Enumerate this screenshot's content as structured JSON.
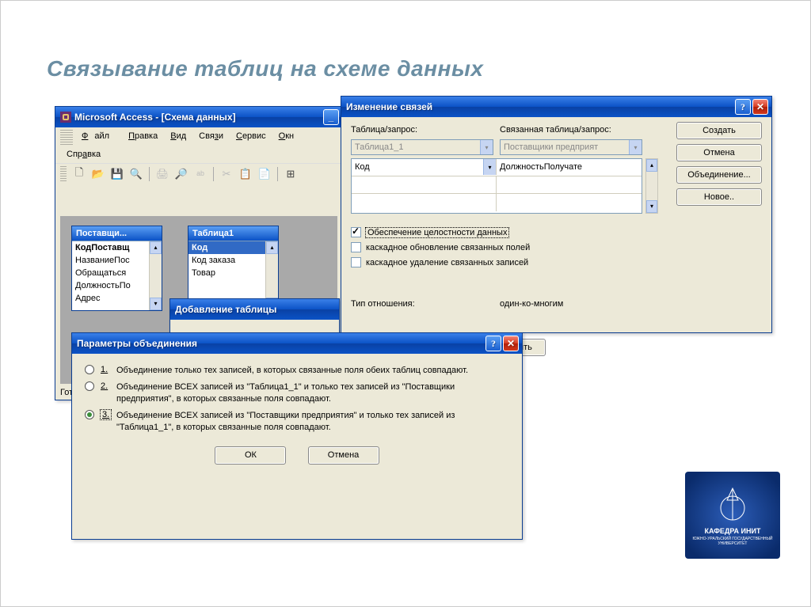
{
  "slide_title": "Связывание таблиц на схеме данных",
  "access_win": {
    "title": "Microsoft Access - [Схема данных]",
    "menu": {
      "file": "Файл",
      "edit": "Правка",
      "view": "Вид",
      "relationships": "Связи",
      "tools": "Сервис",
      "windows": "Окна",
      "help": "Справка"
    },
    "table1": {
      "title": "Поставщи...",
      "fields": [
        "КодПоставщ",
        "НазваниеПос",
        "Обращаться",
        "ДолжностьПо",
        "Адрес"
      ]
    },
    "table2": {
      "title": "Таблица1",
      "fields": [
        "Код",
        "Код заказа",
        "Товар"
      ]
    },
    "status": "Гот"
  },
  "addtable": {
    "title": "Добавление таблицы"
  },
  "editrel": {
    "title": "Изменение связей",
    "labels": {
      "left": "Таблица/запрос:",
      "right": "Связанная таблица/запрос:",
      "rel_type_label": "Тип отношения:",
      "rel_type": "один-ко-многим"
    },
    "values": {
      "left_table": "Таблица1_1",
      "right_table": "Поставщики предприят",
      "left_field": "Код",
      "right_field": "ДолжностьПолучате"
    },
    "checkboxes": {
      "integrity": "Обеспечение целостности данных",
      "cascade_update": "каскадное обновление связанных полей",
      "cascade_delete": "каскадное удаление связанных записей"
    },
    "buttons": {
      "create": "Создать",
      "cancel": "Отмена",
      "join": "Объединение...",
      "new": "Новое.."
    },
    "close_btn": "акрыть"
  },
  "joinparams": {
    "title": "Параметры объединения",
    "options": [
      {
        "num": "1.",
        "text": "Объединение только тех записей, в которых связанные поля обеих таблиц совпадают."
      },
      {
        "num": "2.",
        "text": "Объединение ВСЕХ записей из \"Таблица1_1\" и только тех записей из \"Поставщики предприятия\", в которых связанные поля совпадают."
      },
      {
        "num": "3.",
        "text": "Объединение ВСЕХ записей из \"Поставщики предприятия\" и только тех записей из \"Таблица1_1\", в которых связанные поля совпадают."
      }
    ],
    "buttons": {
      "ok": "ОК",
      "cancel": "Отмена"
    }
  },
  "logo": {
    "line1": "КАФЕДРА ИНИТ",
    "line2": "ЮЖНО-УРАЛЬСКИЙ ГОСУДАРСТВЕННЫЙ УНИВЕРСИТЕТ"
  }
}
